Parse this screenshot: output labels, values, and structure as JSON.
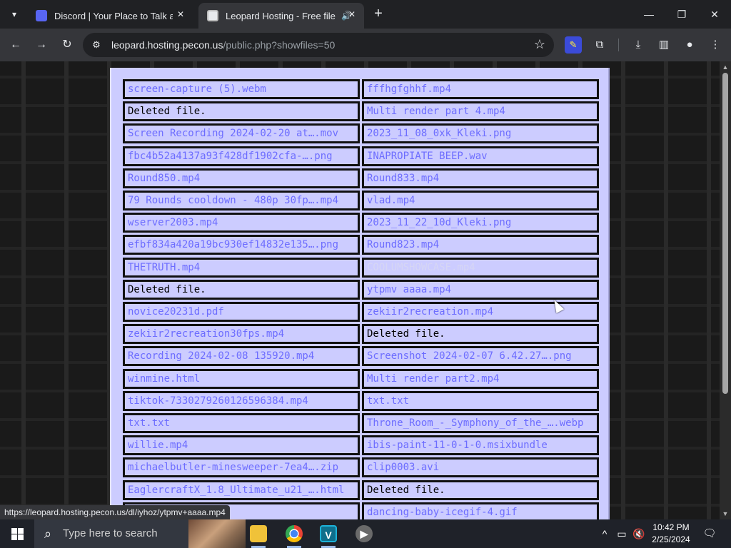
{
  "browser": {
    "tab_search_icon": "chevron-down-icon",
    "tabs": [
      {
        "title": "Discord | Your Place to Talk and Hang Out",
        "favicon": "discord-icon"
      },
      {
        "title": "Leopard Hosting - Free file hosting",
        "favicon": "leopard-icon",
        "audio_icon": "speaker-icon"
      }
    ],
    "new_tab": "+",
    "window": {
      "minimize": "—",
      "maximize": "❐",
      "close": "✕"
    },
    "nav": {
      "back": "←",
      "forward": "→",
      "reload": "↻"
    },
    "url_host": "leopard.hosting.pecon.us",
    "url_path": "/public.php?showfiles=50",
    "star": "☆",
    "status_url": "https://leopard.hosting.pecon.us/dl/iyhoz/ytpmv+aaaa.mp4"
  },
  "files": [
    {
      "name": "screen-capture (5).webm",
      "type": "link"
    },
    {
      "name": "fffhgfghhf.mp4",
      "type": "link"
    },
    {
      "name": "Deleted file.",
      "type": "deleted"
    },
    {
      "name": "Multi render part 4.mp4",
      "type": "link"
    },
    {
      "name": "Screen Recording 2024-02-20 at….mov",
      "type": "link"
    },
    {
      "name": "2023_11_08_0xk_Kleki.png",
      "type": "link"
    },
    {
      "name": "fbc4b52a4137a93f428df1902cfa-….png",
      "type": "link"
    },
    {
      "name": "INAPROPIATE BEEP.wav",
      "type": "link"
    },
    {
      "name": "Round850.mp4",
      "type": "link"
    },
    {
      "name": "Round833.mp4",
      "type": "link"
    },
    {
      "name": "79 Rounds cooldown - 480p 30fp….mp4",
      "type": "link"
    },
    {
      "name": "vlad.mp4",
      "type": "link"
    },
    {
      "name": "wserver2003.mp4",
      "type": "link"
    },
    {
      "name": "2023_11_22_10d_Kleki.png",
      "type": "link"
    },
    {
      "name": "efbf834a420a19bc930ef14832e135….png",
      "type": "link"
    },
    {
      "name": "Round823.mp4",
      "type": "link"
    },
    {
      "name": "THETRUTH.mp4",
      "type": "link"
    },
    {
      "name": "COOLUMSHOWCASE.mp4",
      "type": "faded"
    },
    {
      "name": "Deleted file.",
      "type": "deleted"
    },
    {
      "name": "ytpmv aaaa.mp4",
      "type": "link"
    },
    {
      "name": "novice20231d.pdf",
      "type": "link"
    },
    {
      "name": "zekiir2recreation.mp4",
      "type": "link"
    },
    {
      "name": "zekiir2recreation30fps.mp4",
      "type": "link"
    },
    {
      "name": "Deleted file.",
      "type": "deleted"
    },
    {
      "name": "Recording 2024-02-08 135920.mp4",
      "type": "link"
    },
    {
      "name": "Screenshot 2024-02-07 6.42.27….png",
      "type": "link"
    },
    {
      "name": "winmine.html",
      "type": "link"
    },
    {
      "name": "Multi render part2.mp4",
      "type": "link"
    },
    {
      "name": "tiktok-7330279260126596384.mp4",
      "type": "link"
    },
    {
      "name": "txt.txt",
      "type": "link"
    },
    {
      "name": "txt.txt",
      "type": "link"
    },
    {
      "name": "Throne_Room_-_Symphony_of_the_….webp",
      "type": "link"
    },
    {
      "name": "willie.mp4",
      "type": "link"
    },
    {
      "name": "ibis-paint-11-0-1-0.msixbundle",
      "type": "link"
    },
    {
      "name": "michaelbutler-minesweeper-7ea4….zip",
      "type": "link"
    },
    {
      "name": "clip0003.avi",
      "type": "link"
    },
    {
      "name": "EaglercraftX_1.8_Ultimate_u21_….html",
      "type": "link"
    },
    {
      "name": "Deleted file.",
      "type": "deleted"
    },
    {
      "name": "",
      "type": "link"
    },
    {
      "name": "dancing-baby-icegif-4.gif",
      "type": "link"
    }
  ],
  "taskbar": {
    "search_placeholder": "Type here to search",
    "apps": [
      "file-explorer-icon",
      "chrome-icon",
      "v-app-icon",
      "media-player-icon"
    ],
    "time": "10:42 PM",
    "date": "2/25/2024"
  },
  "colors": {
    "panel": "#ccccff",
    "link": "#6d6dff",
    "deleted": "#000000"
  }
}
